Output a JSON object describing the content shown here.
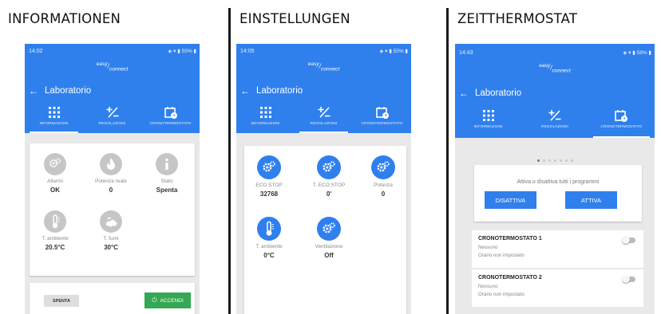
{
  "sections": {
    "informationen": "INFORMATIONEN",
    "einstellungen": "EINSTELLUNGEN",
    "zeitthermostat": "ZEITTHERMOSTAT"
  },
  "app": {
    "brand_html": "easy/connect",
    "title": "Laboratorio",
    "tabs": [
      "INFORMAZIONI",
      "REGOLAZIONI",
      "CRONOTERMOSTATO"
    ],
    "colors": {
      "primary": "#2f80ed",
      "inactive_tile": "#c6c6c6",
      "accendi": "#34a853"
    }
  },
  "screen1": {
    "status": {
      "time": "14:02",
      "battery": "55%"
    },
    "active_tab": 0,
    "tiles": [
      {
        "icon": "gears-icon",
        "label": "Allarmi",
        "value": "OK"
      },
      {
        "icon": "flame-icon",
        "label": "Potenza reale",
        "value": "0"
      },
      {
        "icon": "info-icon",
        "label": "Stato",
        "value": "Spenta"
      },
      {
        "icon": "thermometer-icon",
        "label": "T. ambiente",
        "value": "20.5°C"
      },
      {
        "icon": "smoke-icon",
        "label": "T. fumi",
        "value": "30°C"
      }
    ],
    "btn_spenta": "SPENTA",
    "btn_accendi": "ACCENDI"
  },
  "screen2": {
    "status": {
      "time": "14:05",
      "battery": "55%"
    },
    "active_tab": 1,
    "tiles": [
      {
        "icon": "gears-icon",
        "label": "ECO STOP",
        "value": "32768"
      },
      {
        "icon": "gears-icon",
        "label": "T. ECO STOP",
        "value": "0'"
      },
      {
        "icon": "gears-icon",
        "label": "Potenza",
        "value": "0"
      },
      {
        "icon": "thermometer-icon",
        "label": "T. ambiente",
        "value": "0°C"
      },
      {
        "icon": "gears-icon",
        "label": "Ventilazione",
        "value": "Off"
      }
    ]
  },
  "screen3": {
    "status": {
      "time": "14:43",
      "battery": "58%"
    },
    "active_tab": 2,
    "page_dots": {
      "count": 7,
      "active": 0
    },
    "programs_text": "Attiva o disattiva tutti i programmi",
    "btn_disattiva": "DISATTIVA",
    "btn_attiva": "ATTIVA",
    "cronos": [
      {
        "title": "CRONOTERMOSTATO 1",
        "line1": "Nessuno",
        "line2": "Orario non impostato",
        "enabled": false
      },
      {
        "title": "CRONOTERMOSTATO 2",
        "line1": "Nessuno",
        "line2": "Orario non impostato",
        "enabled": false
      }
    ]
  }
}
